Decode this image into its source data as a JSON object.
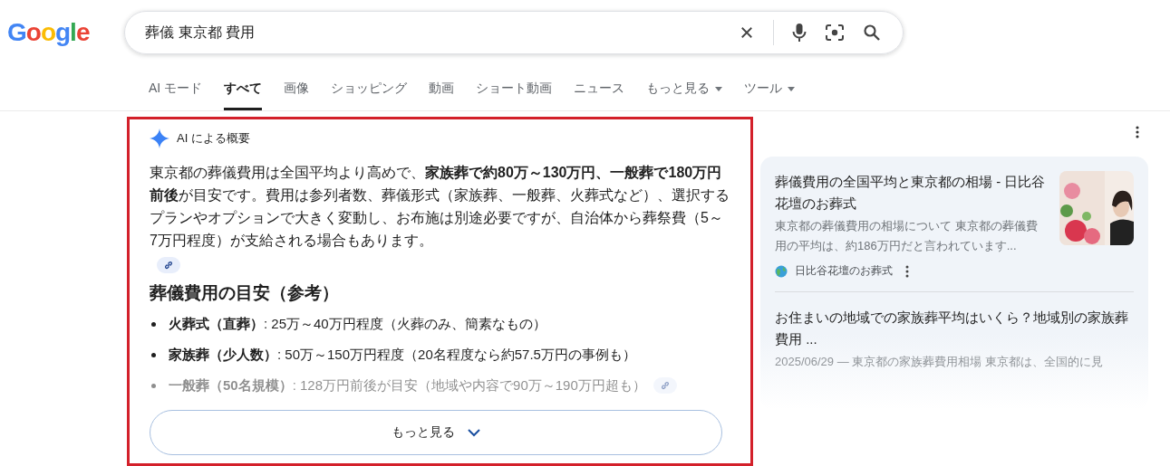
{
  "logo": "Google",
  "search": {
    "value": "葬儀 東京都 費用"
  },
  "tabs": [
    {
      "label": "AI モード",
      "selected": false,
      "dropdown": false
    },
    {
      "label": "すべて",
      "selected": true,
      "dropdown": false
    },
    {
      "label": "画像",
      "selected": false,
      "dropdown": false
    },
    {
      "label": "ショッピング",
      "selected": false,
      "dropdown": false
    },
    {
      "label": "動画",
      "selected": false,
      "dropdown": false
    },
    {
      "label": "ショート動画",
      "selected": false,
      "dropdown": false
    },
    {
      "label": "ニュース",
      "selected": false,
      "dropdown": false
    },
    {
      "label": "もっと見る",
      "selected": false,
      "dropdown": true
    },
    {
      "label": "ツール",
      "selected": false,
      "dropdown": true
    }
  ],
  "ai_overview": {
    "title": "AI による概要",
    "summary": "東京都の葬儀費用は全国平均より高めで、**家族葬で約80万～130万円、一般葬で180万円前後**が目安です。費用は参列者数、葬儀形式（家族葬、一般葬、火葬式など）、選択するプランやオプションで大きく変動し、お布施は別途必要ですが、自治体から葬祭費（5～7万円程度）が支給される場合もあります。",
    "heading": "葬儀費用の目安（参考）",
    "bullets": [
      {
        "text": "**火葬式（直葬）**: 25万～40万円程度（火葬のみ、簡素なもの）",
        "faded": false,
        "link": false
      },
      {
        "text": "**家族葬（少人数）**: 50万～150万円程度（20名程度なら約57.5万円の事例も）",
        "faded": false,
        "link": false
      },
      {
        "text": "**一般葬（50名規模）**: 128万円前後が目安（地域や内容で90万～190万円超も）",
        "faded": true,
        "link": true
      }
    ],
    "more_button": "もっと見る"
  },
  "sources": [
    {
      "title": "葬儀費用の全国平均と東京都の相場 - 日比谷花壇のお葬式",
      "snippet": "東京都の葬儀費用の相場について 東京都の葬儀費用の平均は、約186万円だと言われています...",
      "site": "日比谷花壇のお葬式",
      "faded": false
    },
    {
      "title": "お住まいの地域での家族葬平均はいくら？地域別の家族葬費用 ...",
      "snippet": "2025/06/29 — 東京都の家族葬費用相場 東京都は、全国的に見",
      "faded": true
    }
  ]
}
